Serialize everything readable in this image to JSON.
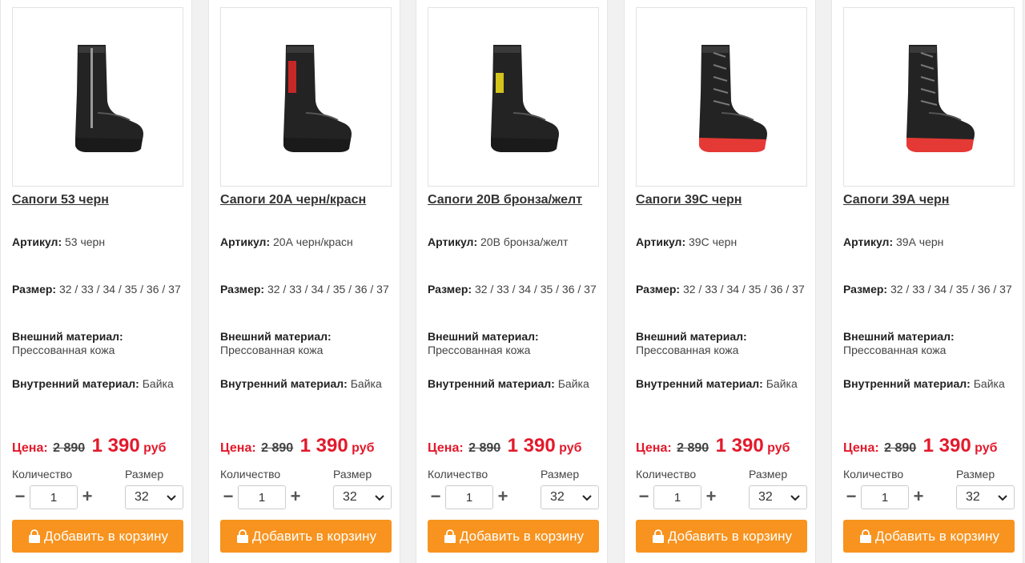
{
  "labels": {
    "article": "Артикул:",
    "size": "Размер:",
    "outer": "Внешний материал:",
    "inner": "Внутренний материал:",
    "price": "Цена:",
    "currency": "руб",
    "quantity": "Количество",
    "size_select": "Размер",
    "add_to_cart": "Добавить в корзину",
    "minus": "−",
    "plus": "+"
  },
  "colors": {
    "accent": "#f7931e",
    "price": "#e3192b"
  },
  "products": [
    {
      "title": "Сапоги 53 черн",
      "article": "53 черн",
      "sizes": "32 / 33 / 34 / 35 / 36 / 37",
      "outer": "Прессованная кожа",
      "inner": "Байка",
      "old_price": "2 890",
      "new_price": "1 390",
      "quantity": "1",
      "size": "32",
      "icon": "boot-zip-image"
    },
    {
      "title": "Сапоги 20А черн/красн",
      "article": "20А черн/красн",
      "sizes": "32 / 33 / 34 / 35 / 36 / 37",
      "outer": "Прессованная кожа",
      "inner": "Байка",
      "old_price": "2 890",
      "new_price": "1 390",
      "quantity": "1",
      "size": "32",
      "icon": "boot-red-strap-image"
    },
    {
      "title": "Сапоги 20В бронза/желт",
      "article": "20В бронза/желт",
      "sizes": "32 / 33 / 34 / 35 / 36 / 37",
      "outer": "Прессованная кожа",
      "inner": "Байка",
      "old_price": "2 890",
      "new_price": "1 390",
      "quantity": "1",
      "size": "32",
      "icon": "boot-yellow-strap-image"
    },
    {
      "title": "Сапоги 39С черн",
      "article": "39С черн",
      "sizes": "32 / 33 / 34 / 35 / 36 / 37",
      "outer": "Прессованная кожа",
      "inner": "Байка",
      "old_price": "2 890",
      "new_price": "1 390",
      "quantity": "1",
      "size": "32",
      "icon": "boot-laced-red-sole-image"
    },
    {
      "title": "Сапоги 39А черн",
      "article": "39А черн",
      "sizes": "32 / 33 / 34 / 35 / 36 / 37",
      "outer": "Прессованная кожа",
      "inner": "Байка",
      "old_price": "2 890",
      "new_price": "1 390",
      "quantity": "1",
      "size": "32",
      "icon": "boot-laced-red-sole-image"
    }
  ]
}
